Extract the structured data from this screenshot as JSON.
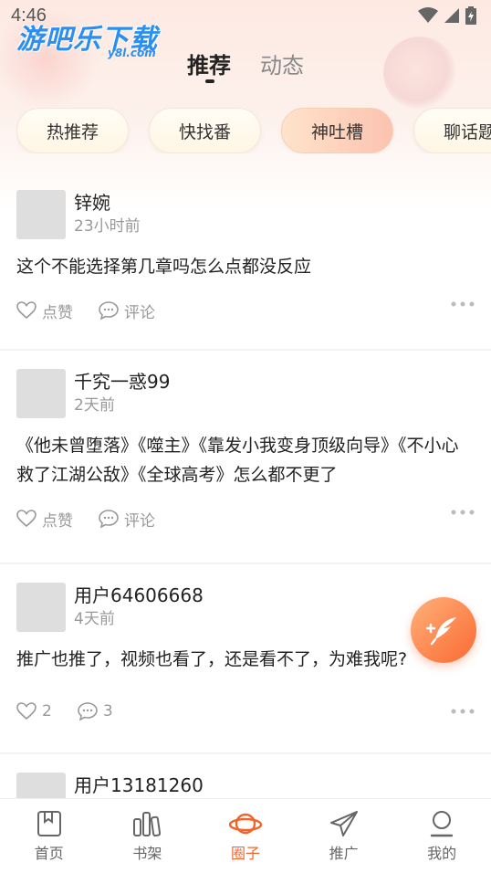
{
  "status_bar": {
    "time": "4:46"
  },
  "logo": {
    "main": "游吧乐下载",
    "sub": "y8l.com"
  },
  "tabs": [
    {
      "label": "推荐",
      "active": true
    },
    {
      "label": "动态",
      "active": false
    }
  ],
  "chips": [
    {
      "label": "热推荐",
      "active": false
    },
    {
      "label": "快找番",
      "active": false
    },
    {
      "label": "神吐槽",
      "active": true
    },
    {
      "label": "聊话题",
      "active": false
    }
  ],
  "posts": [
    {
      "username": "锌婉",
      "time": "23小时前",
      "text": "这个不能选择第几章吗怎么点都没反应",
      "like_label": "点赞",
      "comment_label": "评论"
    },
    {
      "username": "千究一惑99",
      "time": "2天前",
      "text": "《他未曾堕落》《噬主》《靠发小我变身顶级向导》《不小心救了江湖公敌》《全球高考》怎么都不更了",
      "like_label": "点赞",
      "comment_label": "评论"
    },
    {
      "username": "用户64606668",
      "time": "4天前",
      "text": "推广也推了，视频也看了，还是看不了，为难我呢?",
      "like_label": "2",
      "comment_label": "3"
    },
    {
      "username": "用户13181260",
      "time": "",
      "text": "",
      "like_label": "",
      "comment_label": ""
    }
  ],
  "bottom_nav": [
    {
      "label": "首页",
      "icon": "book-icon",
      "active": false
    },
    {
      "label": "书架",
      "icon": "bookshelf-icon",
      "active": false
    },
    {
      "label": "圈子",
      "icon": "planet-icon",
      "active": true
    },
    {
      "label": "推广",
      "icon": "paper-plane-icon",
      "active": false
    },
    {
      "label": "我的",
      "icon": "profile-icon",
      "active": false
    }
  ],
  "colors": {
    "accent": "#f0642c",
    "logo_blue": "#2c8ff0",
    "active_chip": "#fbc3b0"
  }
}
